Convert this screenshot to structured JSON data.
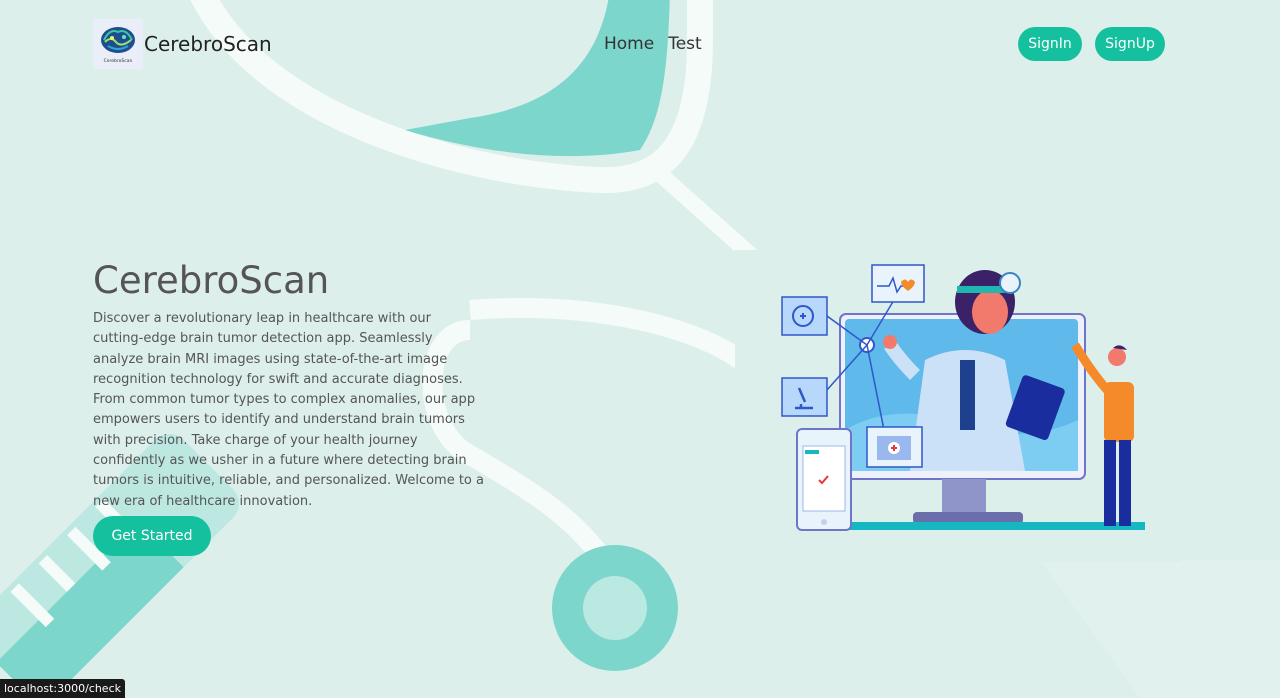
{
  "navbar": {
    "brand": "CerebroScan",
    "logo_caption": "CerebroScan",
    "links": [
      "Home",
      "Test"
    ],
    "signin_label": "SignIn",
    "signup_label": "SignUp"
  },
  "hero": {
    "title": "CerebroScan",
    "description": "Discover a revolutionary leap in healthcare with our cutting-edge brain tumor detection app. Seamlessly analyze brain MRI images using state-of-the-art image recognition technology for swift and accurate diagnoses. From common tumor types to complex anomalies, our app empowers users to identify and understand brain tumors with precision. Take charge of your health journey confidently as we usher in a future where detecting brain tumors is intuitive, reliable, and personalized. Welcome to a new era of healthcare innovation.",
    "cta_label": "Get Started"
  },
  "status_bar": {
    "url": "localhost:3000/check"
  },
  "colors": {
    "background": "#ddefeb",
    "accent": "#15c09f",
    "stethoscope": "#7dd6cb"
  },
  "icons": [
    "brain-logo-icon",
    "stethoscope-icon",
    "heartbeat-icon",
    "microscope-icon",
    "folder-medical-icon",
    "calendar-phone-icon"
  ]
}
